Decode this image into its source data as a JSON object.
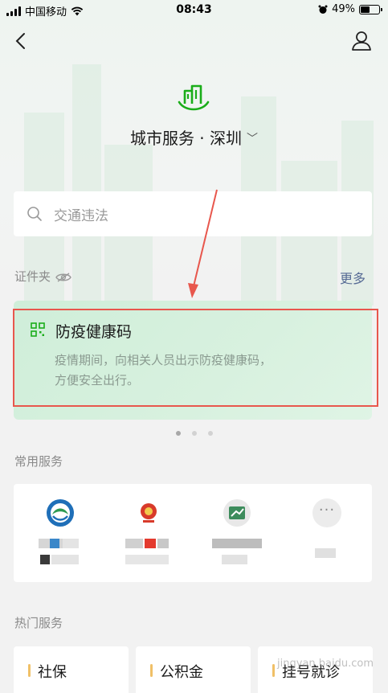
{
  "status_bar": {
    "carrier": "中国移动",
    "time": "08:43",
    "battery_text": "49%",
    "battery_level": 0.49
  },
  "header": {
    "city_title": "城市服务 · 深圳"
  },
  "search": {
    "placeholder": "交通违法"
  },
  "credentials": {
    "label": "证件夹",
    "more": "更多",
    "card_title": "防疫健康码",
    "card_desc": "疫情期间，向相关人员出示防疫健康码，方便安全出行。"
  },
  "common_services": {
    "label": "常用服务"
  },
  "hot_services": {
    "label": "热门服务",
    "items": [
      "社保",
      "公积金",
      "挂号就诊"
    ]
  },
  "watermark": "jingyan.baidu.com",
  "colors": {
    "brand_green": "#1aad19",
    "link_blue": "#576b95",
    "annotation_red": "#e8574d",
    "accent_yellow": "#f0c067"
  }
}
